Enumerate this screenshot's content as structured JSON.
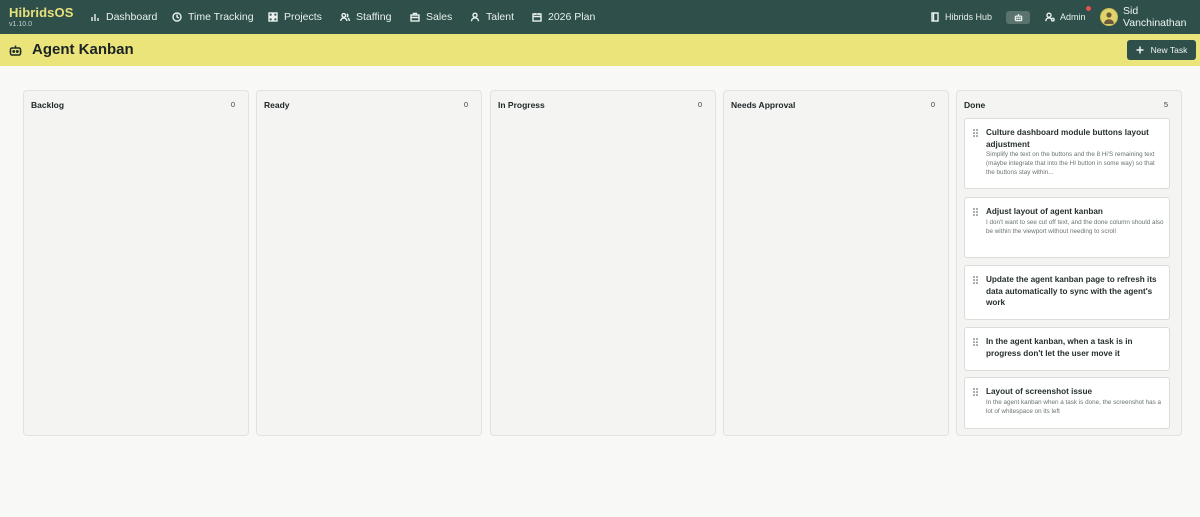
{
  "app": {
    "name": "HibridsOS",
    "version": "v1.10.0"
  },
  "nav": {
    "items": [
      {
        "label": "Dashboard",
        "icon": "bar-chart-icon"
      },
      {
        "label": "Time Tracking",
        "icon": "clock-icon"
      },
      {
        "label": "Projects",
        "icon": "grid-icon"
      },
      {
        "label": "Staffing",
        "icon": "users-icon"
      },
      {
        "label": "Sales",
        "icon": "briefcase-icon"
      },
      {
        "label": "Talent",
        "icon": "person-icon"
      },
      {
        "label": "2026 Plan",
        "icon": "calendar-icon"
      }
    ],
    "hub_label": "Hibrids Hub",
    "admin_label": "Admin",
    "user_name": "Sid Vanchinathan"
  },
  "page": {
    "title": "Agent Kanban",
    "new_task_label": "New Task"
  },
  "columns": [
    {
      "title": "Backlog",
      "count": "0"
    },
    {
      "title": "Ready",
      "count": "0"
    },
    {
      "title": "In Progress",
      "count": "0"
    },
    {
      "title": "Needs Approval",
      "count": "0"
    },
    {
      "title": "Done",
      "count": "5"
    }
  ],
  "done_cards": [
    {
      "title": "Culture dashboard module buttons layout adjustment",
      "description": "Simplify the text on the buttons and the 8 Hi'S remaining text (maybe integrate that into the HI button in some way) so that the buttons stay within..."
    },
    {
      "title": "Adjust layout of agent kanban",
      "description": "I don't want to see cut off text, and the done column should also be within the viewport without needing to scroll"
    },
    {
      "title": "Update the agent kanban page to refresh its data automatically to sync with the agent's work",
      "description": ""
    },
    {
      "title": "In the agent kanban, when a task is in progress don't let the user move it",
      "description": ""
    },
    {
      "title": "Layout of screenshot issue",
      "description": "In the agent kanban when a task is done, the screenshot has a lot of whitespace on its left"
    }
  ],
  "colors": {
    "nav_bg": "#2e4f4a",
    "header_bg": "#ebe47a",
    "brand": "#e8e07a",
    "notification": "#e5534b"
  }
}
